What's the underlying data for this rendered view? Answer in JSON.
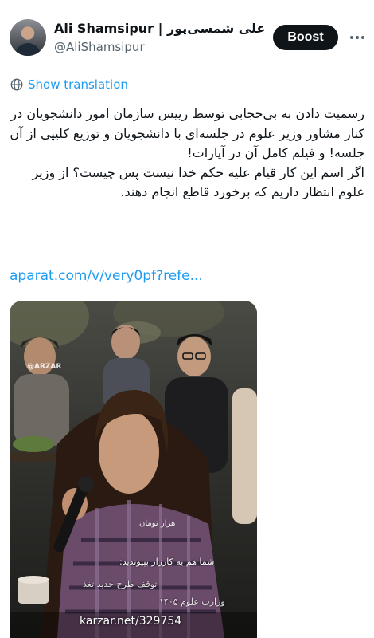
{
  "author": {
    "display_name": "Ali Shamsipur | علی شمسی‌پور",
    "handle": "@AliShamsipur",
    "avatar_icon": "profile-avatar"
  },
  "actions": {
    "boost_label": "Boost",
    "more_icon": "more-horizontal-icon"
  },
  "translation": {
    "label": "Show translation",
    "icon": "globe-icon",
    "color": "#1d9bf0"
  },
  "tweet": {
    "paragraph_1": "رسمیت دادن به بی‌حجابی توسط رییس سازمان امور دانشجویان در کنار مشاور وزیر علوم در جلسه‌ای با دانشجویان و توزیع کلیپی از آن جلسه! و فیلم کامل آن در آپارات!",
    "paragraph_2": "اگر اسم این کار قیام علیه حکم خدا نیست پس چیست؟ از وزیر علوم انتظار داریم که برخورد قاطع انجام دهند."
  },
  "link": {
    "text": "aparat.com/v/very0pf?refe..."
  },
  "media": {
    "watermark": "@ARZAR",
    "overlay_small": "هزار تومان",
    "overlay_line_1": "شما هم به کارزار بپیوندید:",
    "overlay_line_2": "توقف طرح جدید تغذ",
    "overlay_line_3": "وزارت علوم ۱۴۰۵",
    "source": "karzar.net/329754"
  },
  "colors": {
    "text": "#0f1419",
    "secondary": "#536471",
    "accent": "#1d9bf0",
    "button_bg": "#0f1419"
  }
}
